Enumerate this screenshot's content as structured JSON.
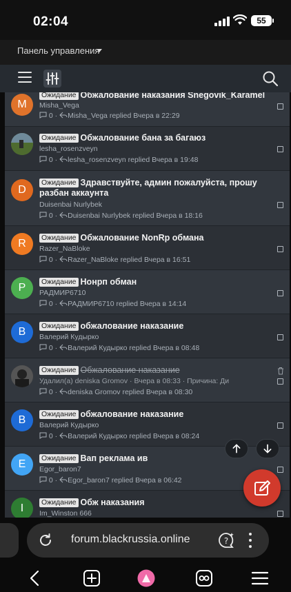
{
  "status": {
    "time": "02:04",
    "battery": "55"
  },
  "admin": {
    "panel_label": "Панель управления"
  },
  "threads": [
    {
      "avatar_letter": "M",
      "avatar_color": "#e0732b",
      "badge": "Ожидание",
      "title": "Обжалование наказания Snegovik_Karamel",
      "author": "Misha_Vega",
      "replies": "0",
      "last": "Misha_Vega replied Вчера в 22:29"
    },
    {
      "avatar_letter": "",
      "avatar_color": "#4f6a3a",
      "badge": "Ожидание",
      "title": "Обжалование бана за багаюз",
      "author": "lesha_rosenzveyn",
      "replies": "0",
      "last": "lesha_rosenzveyn replied Вчера в 19:48"
    },
    {
      "avatar_letter": "D",
      "avatar_color": "#e0691f",
      "badge": "Ожидание",
      "title": "Здравствуйте, админ пожалуйста, прошу разбан аккаунта",
      "author": "Duisenbai Nurlybek",
      "replies": "0",
      "last": "Duisenbai Nurlybek replied Вчера в 18:16"
    },
    {
      "avatar_letter": "R",
      "avatar_color": "#ef7a22",
      "badge": "Ожидание",
      "title": "Обжалование NonRp обмана",
      "author": "Razer_NaBloke",
      "replies": "0",
      "last": "Razer_NaBloke replied Вчера в 16:51"
    },
    {
      "avatar_letter": "P",
      "avatar_color": "#4caf50",
      "badge": "Ожидание",
      "title": "Нонрп обман",
      "author": "РАДМИР6710",
      "replies": "0",
      "last": "РАДМИР6710 replied Вчера в 14:14"
    },
    {
      "avatar_letter": "B",
      "avatar_color": "#1e6bd6",
      "badge": "Ожидание",
      "title": "обжалование наказание",
      "author": "Валерий Кудырко",
      "replies": "0",
      "last": "Валерий Кудырко replied Вчера в 08:48"
    },
    {
      "avatar_letter": "",
      "avatar_color": "#3a3a3a",
      "badge": "Ожидание",
      "title": "Обжалование наказание",
      "deleted_info": "Удалил(а) deniska Gromov · Вчера в 08:33 · Причина: Ди",
      "replies": "0",
      "last": "deniska Gromov replied Вчера в 08:30"
    },
    {
      "avatar_letter": "B",
      "avatar_color": "#1e6bd6",
      "badge": "Ожидание",
      "title": "обжалование наказание",
      "author": "Валерий Кудырко",
      "replies": "0",
      "last": "Валерий Кудырко replied Вчера в 08:24"
    },
    {
      "avatar_letter": "E",
      "avatar_color": "#42a5f5",
      "badge": "Ожидание",
      "title": "Вап реклама ив",
      "author": "Egor_baron7",
      "replies": "0",
      "last": "Egor_baron7 replied Вчера в 06:42"
    },
    {
      "avatar_letter": "I",
      "avatar_color": "#2e7d32",
      "badge": "Ожидание",
      "title": "Обж наказания",
      "author": "Im_Winston 666"
    }
  ],
  "browser": {
    "url": "forum.blackrussia.online"
  }
}
